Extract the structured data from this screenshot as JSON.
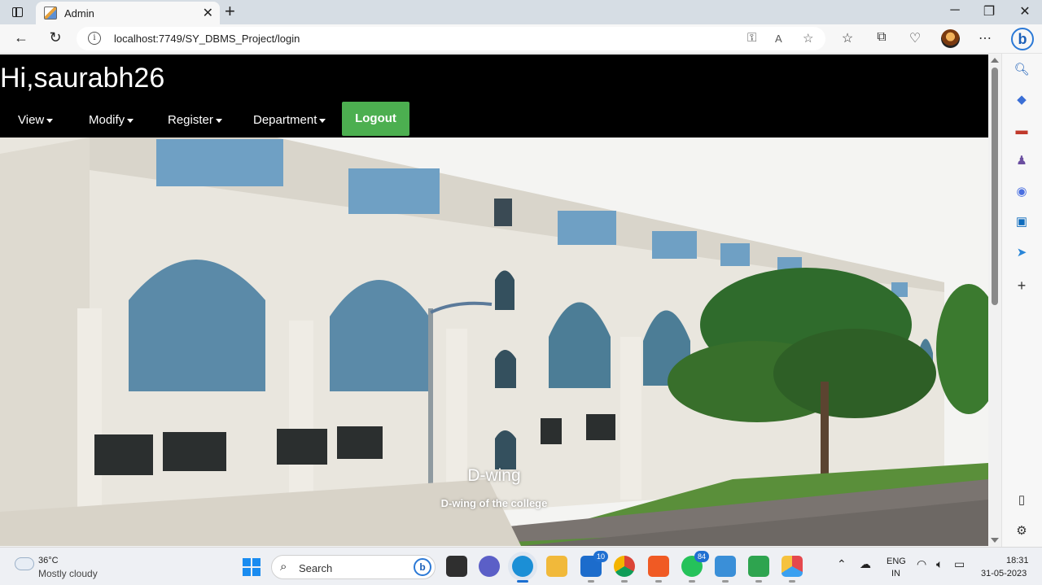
{
  "browser": {
    "tab_title": "Admin",
    "url": "localhost:7749/SY_DBMS_Project/login"
  },
  "site": {
    "greeting": "Hi,saurabh26",
    "menu": [
      {
        "label": "View"
      },
      {
        "label": "Modify"
      },
      {
        "label": "Register"
      },
      {
        "label": "Department"
      }
    ],
    "logout_label": "Logout",
    "logout_color": "#4caf50"
  },
  "carousel": {
    "caption_title": "D-wing",
    "caption_text": "D-wing of the college"
  },
  "taskbar": {
    "temperature": "36°C",
    "condition": "Mostly cloudy",
    "search_placeholder": "Search",
    "mail_badge": "10",
    "whatsapp_badge": "84",
    "lang_line1": "ENG",
    "lang_line2": "IN",
    "time": "18:31",
    "date": "31-05-2023"
  },
  "icons": {
    "sidebar": [
      "search-icon",
      "tag-icon",
      "toolbox-icon",
      "games-icon",
      "office-icon",
      "outlook-icon",
      "send-icon",
      "add-icon",
      "panel-icon",
      "settings-icon"
    ]
  }
}
